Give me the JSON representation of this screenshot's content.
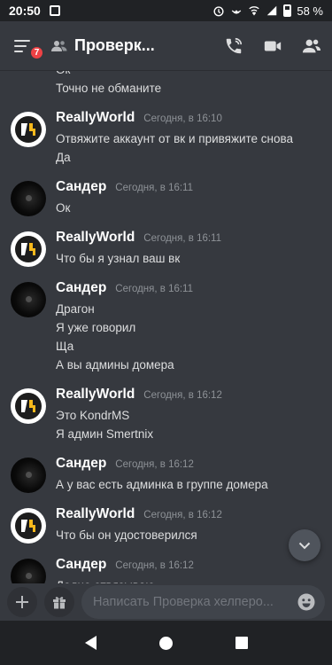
{
  "status": {
    "time": "20:50",
    "battery": "58 %"
  },
  "header": {
    "channel_title": "Проверк...",
    "notification_count": "7"
  },
  "messages": [
    {
      "type": "continuation",
      "lines": [
        "Ок",
        "Точно не обманите"
      ]
    },
    {
      "author": "ReallyWorld",
      "avatar": "rw",
      "timestamp": "Сегодня, в 16:10",
      "lines": [
        "Отвяжите аккаунт от вк и привяжите снова",
        "Да"
      ]
    },
    {
      "author": "Сандер",
      "avatar": "dark",
      "timestamp": "Сегодня, в 16:11",
      "lines": [
        "Ок"
      ]
    },
    {
      "author": "ReallyWorld",
      "avatar": "rw",
      "timestamp": "Сегодня, в 16:11",
      "lines": [
        "Что бы я узнал ваш вк"
      ]
    },
    {
      "author": "Сандер",
      "avatar": "dark",
      "timestamp": "Сегодня, в 16:11",
      "lines": [
        "Драгон",
        "Я уже говорил",
        "Ща",
        "А вы админы домера"
      ]
    },
    {
      "author": "ReallyWorld",
      "avatar": "rw",
      "timestamp": "Сегодня, в 16:12",
      "lines": [
        "Это KondrMS",
        "Я админ Smertnix"
      ]
    },
    {
      "author": "Сандер",
      "avatar": "dark",
      "timestamp": "Сегодня, в 16:12",
      "lines": [
        "А у вас есть админка в группе домера"
      ]
    },
    {
      "author": "ReallyWorld",
      "avatar": "rw",
      "timestamp": "Сегодня, в 16:12",
      "lines": [
        "Что бы он удостоверился"
      ]
    },
    {
      "author": "Сандер",
      "avatar": "dark",
      "timestamp": "Сегодня, в 16:12",
      "lines": [
        "Дадно отвязываю"
      ]
    }
  ],
  "composer": {
    "placeholder": "Написать Проверка хелперо..."
  },
  "icons": {
    "menu": "hamburger-icon",
    "channel": "people-icon",
    "call": "phone-icon",
    "video": "video-icon",
    "members": "members-icon",
    "add": "plus-icon",
    "gift": "gift-icon",
    "emoji": "emoji-icon",
    "scroll": "chevron-down-icon"
  },
  "colors": {
    "background": "#36393f",
    "badge": "#ed4245",
    "rw_logo": "#f5b81c"
  }
}
